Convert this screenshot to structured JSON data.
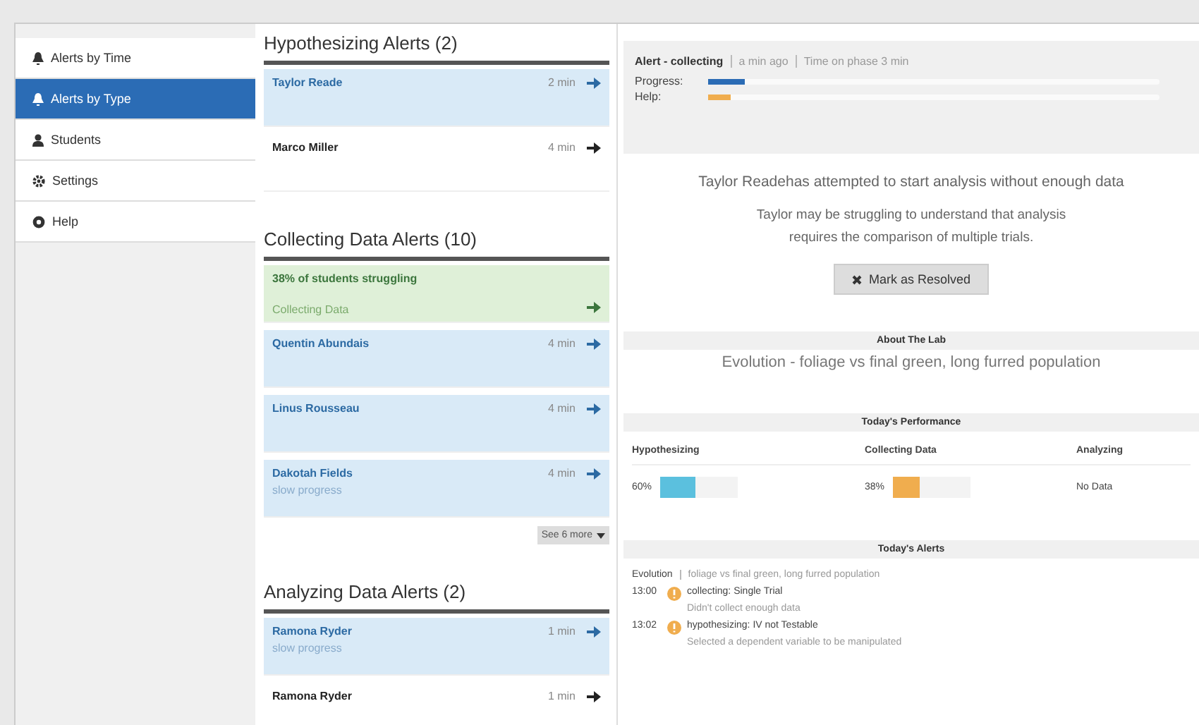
{
  "sidebar": {
    "items": [
      {
        "label": "Alerts by Time",
        "selected": false
      },
      {
        "label": "Alerts by Type",
        "selected": true
      },
      {
        "label": "Students",
        "selected": false
      },
      {
        "label": "Settings",
        "selected": false
      },
      {
        "label": "Help",
        "selected": false
      }
    ]
  },
  "alert_groups": [
    {
      "title": "Hypothesizing Alerts (2)",
      "alerts": [
        {
          "kind": "student",
          "name": "Taylor Reade",
          "time": "2 min",
          "unread": true
        },
        {
          "kind": "student",
          "name": "Marco Miller",
          "time": "4 min",
          "unread": false
        }
      ]
    },
    {
      "title": "Collecting Data Alerts (10)",
      "alerts": [
        {
          "kind": "summary",
          "name": "38% of students struggling",
          "subtitle": "Collecting Data"
        },
        {
          "kind": "student",
          "name": "Quentin Abundais",
          "time": "4 min",
          "unread": true
        },
        {
          "kind": "student",
          "name": "Linus Rousseau",
          "time": "4 min",
          "unread": true
        },
        {
          "kind": "student",
          "name": "Dakotah Fields",
          "time": "4 min",
          "subtitle": "slow progress",
          "unread": true
        }
      ],
      "more": "See 6 more"
    },
    {
      "title": "Analyzing Data Alerts (2)",
      "alerts": [
        {
          "kind": "student",
          "name": "Ramona Ryder",
          "time": "1 min",
          "subtitle": "slow progress",
          "unread": true
        },
        {
          "kind": "student",
          "name": "Ramona Ryder",
          "time": "1 min",
          "unread": false
        }
      ]
    }
  ],
  "detail": {
    "title": "Alert - collecting",
    "ago": "a min ago",
    "phase_time": "Time on phase 3 min",
    "progress_label": "Progress:",
    "progress": {
      "level": 0.08
    },
    "help_label": "Help:",
    "help": {
      "level": 0.05
    },
    "message": "Taylor Readehas attempted to start analysis without enough data",
    "explanation": "Taylor may be struggling to understand that analysis requires the comparison of multiple trials.",
    "resolve_button": "Mark as Resolved",
    "about_title": "About The Lab",
    "about_text": "Evolution - foliage vs final green, long furred population",
    "performance_title": "Today's Performance",
    "performance": [
      {
        "phase": "Hypothesizing",
        "value": "60%",
        "level": 0.45,
        "color": "#5bc0de"
      },
      {
        "phase": "Collecting Data",
        "value": "38%",
        "level": 0.35,
        "color": "#f0ad4e"
      },
      {
        "phase": "Analyzing",
        "value": "No Data"
      }
    ],
    "alerts_title": "Today's Alerts",
    "lab_name": "Evolution",
    "lab_detail": "foliage vs final green, long furred population",
    "todays_alerts": [
      {
        "time": "13:00",
        "title": "collecting: Single Trial",
        "text": "Didn't collect enough data"
      },
      {
        "time": "13:02",
        "title": "hypothesizing: IV not Testable",
        "text": "Selected a dependent variable to be manipulated"
      }
    ]
  }
}
